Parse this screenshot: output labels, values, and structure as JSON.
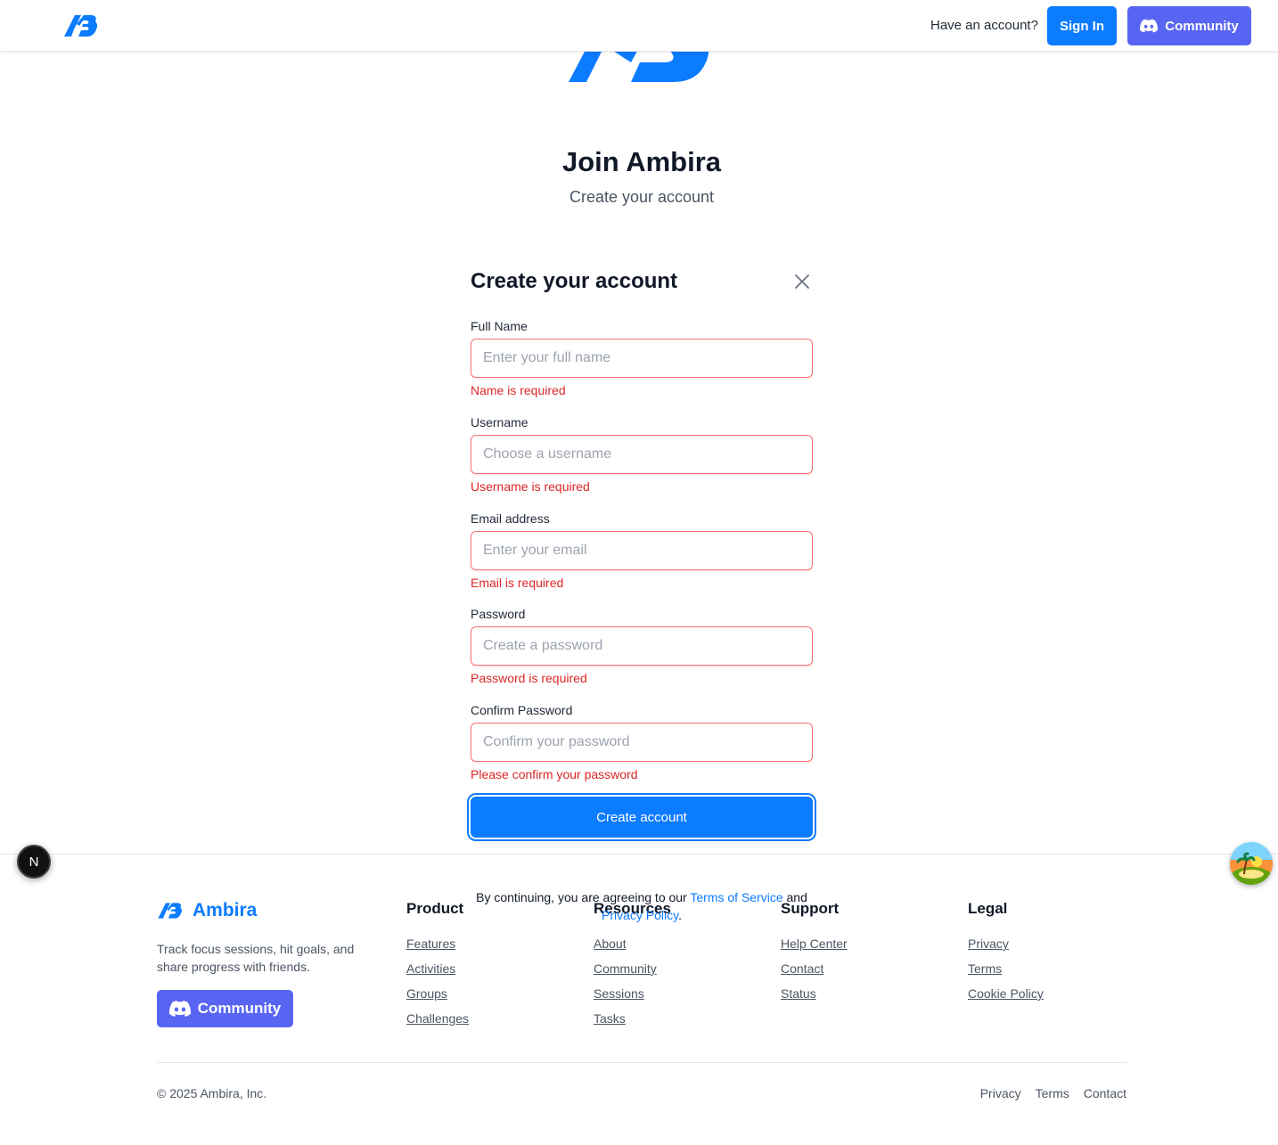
{
  "header": {
    "have_account": "Have an account?",
    "sign_in": "Sign In",
    "community": "Community"
  },
  "hero": {
    "title": "Join Ambira",
    "subtitle": "Create your account"
  },
  "form": {
    "title": "Create your account",
    "fields": [
      {
        "label": "Full Name",
        "placeholder": "Enter your full name",
        "error": "Name is required",
        "type": "text"
      },
      {
        "label": "Username",
        "placeholder": "Choose a username",
        "error": "Username is required",
        "type": "text"
      },
      {
        "label": "Email address",
        "placeholder": "Enter your email",
        "error": "Email is required",
        "type": "email"
      },
      {
        "label": "Password",
        "placeholder": "Create a password",
        "error": "Password is required",
        "type": "password"
      },
      {
        "label": "Confirm Password",
        "placeholder": "Confirm your password",
        "error": "Please confirm your password",
        "type": "password"
      }
    ],
    "submit": "Create account"
  },
  "consent": {
    "prefix": "By continuing, you are agreeing to our ",
    "terms": "Terms of Service",
    "and": " and ",
    "privacy": "Privacy Policy",
    "suffix": "."
  },
  "badges": {
    "n_letter": "N"
  },
  "footer": {
    "brand": "Ambira",
    "tagline": "Track focus sessions, hit goals, and share progress with friends.",
    "community": "Community",
    "columns": [
      {
        "heading": "Product",
        "links": [
          "Features",
          "Activities",
          "Groups",
          "Challenges"
        ]
      },
      {
        "heading": "Resources",
        "links": [
          "About",
          "Community",
          "Sessions",
          "Tasks"
        ]
      },
      {
        "heading": "Support",
        "links": [
          "Help Center",
          "Contact",
          "Status"
        ]
      },
      {
        "heading": "Legal",
        "links": [
          "Privacy",
          "Terms",
          "Cookie Policy"
        ]
      }
    ],
    "copyright": "© 2025 Ambira, Inc.",
    "bottom_links": [
      "Privacy",
      "Terms",
      "Contact"
    ]
  },
  "colors": {
    "brand_blue": "#0b7bff",
    "discord": "#5865f2",
    "error": "#dc2626",
    "error_border": "#f87171"
  }
}
